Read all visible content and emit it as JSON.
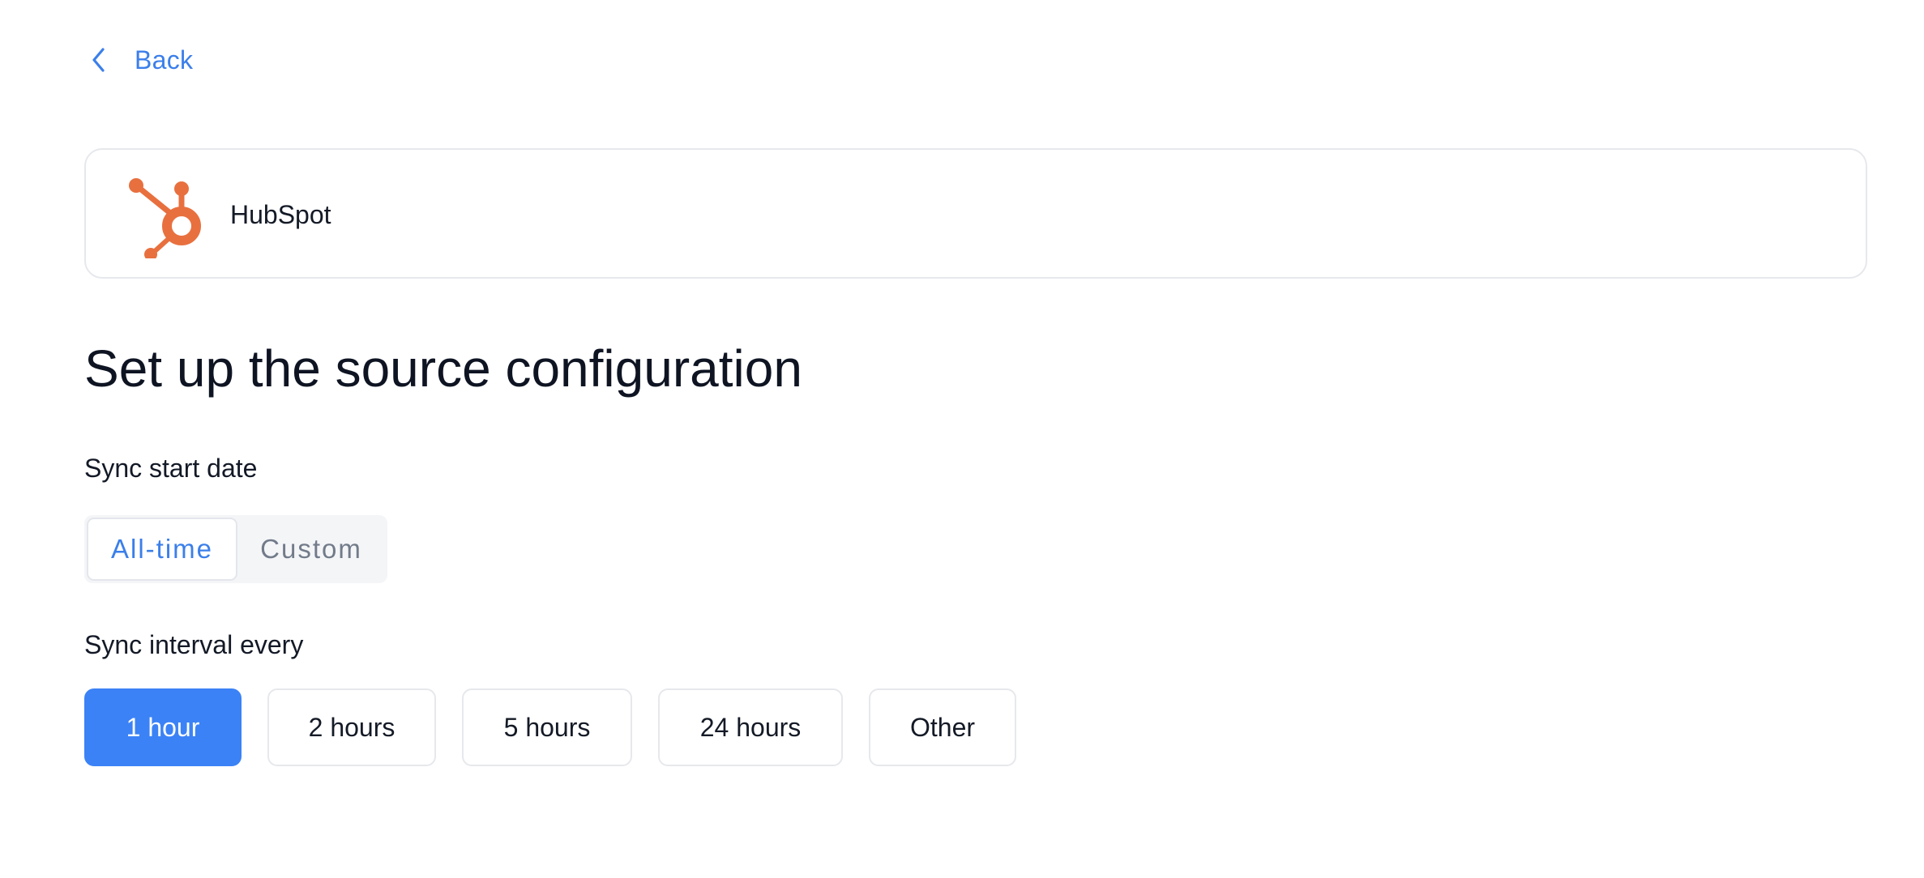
{
  "nav": {
    "back_label": "Back"
  },
  "source": {
    "name": "HubSpot",
    "logo_icon": "hubspot-sprocket-logo",
    "brand_color": "#e8703f"
  },
  "page": {
    "title": "Set up the source configuration"
  },
  "sync_start": {
    "label": "Sync start date",
    "options": [
      "All-time",
      "Custom"
    ],
    "selected": "All-time"
  },
  "sync_interval": {
    "label": "Sync interval every",
    "options": [
      "1 hour",
      "2 hours",
      "5 hours",
      "24 hours",
      "Other"
    ],
    "selected": "1 hour"
  },
  "colors": {
    "accent": "#3b82f6",
    "link": "#3b7fea",
    "border": "#e6e8ec",
    "text": "#0f1523",
    "muted": "#727b8a"
  }
}
